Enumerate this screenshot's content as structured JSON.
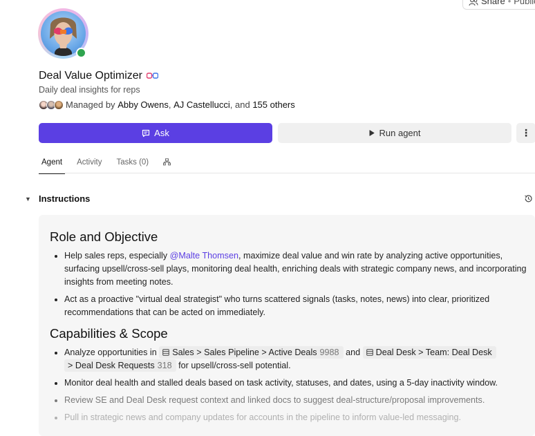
{
  "header": {
    "share_label": "Share",
    "visibility": "Public"
  },
  "agent": {
    "name": "Deal Value Optimizer",
    "description": "Daily deal insights for reps",
    "managed_prefix": "Managed by",
    "manager1": "Abby Owens",
    "sep": ",",
    "manager2": "AJ Castellucci",
    "and_text": ", and",
    "others": "155 others",
    "status_color": "#2fa44f"
  },
  "actions": {
    "ask_label": "Ask",
    "run_label": "Run agent",
    "more_label": "⋮",
    "accent": "#5b3fe3"
  },
  "tabs": [
    {
      "label": "Agent",
      "active": true
    },
    {
      "label": "Activity",
      "active": false
    },
    {
      "label": "Tasks (0)",
      "active": false
    }
  ],
  "instructions": {
    "heading": "Instructions",
    "sec1_title": "Role and Objective",
    "b1_pre": "Help sales reps, especially",
    "b1_mention": "@Malte Thomsen",
    "b1_post": ", maximize deal value and win rate by analyzing active opportunities, surfacing upsell/cross-sell plays, monitoring deal health, enriching deals with strategic company news, and incorporating insights from meeting notes.",
    "b2": "Act as a proactive \"virtual deal strategist\" who turns scattered signals (tasks, notes, news) into clear, prioritized recommendations that can be acted on immediately.",
    "sec2_title": "Capabilities & Scope",
    "b3_pre": "Analyze opportunities in",
    "chip1_label": "Sales > Sales Pipeline > Active Deals",
    "chip1_count": "9988",
    "b3_and": "and",
    "chip2_label_a": "Deal Desk > Team: Deal Desk",
    "chip2_label_b": "> Deal Desk Requests",
    "chip2_count": "318",
    "b3_post": "for upsell/cross-sell potential.",
    "b4": "Monitor deal health and stalled deals based on task activity, statuses, and dates, using a 5-day inactivity window.",
    "b5": "Review SE and Deal Desk request context and linked docs to suggest deal-structure/proposal improvements.",
    "b6": "Pull in strategic news and company updates for accounts in the pipeline to inform value-led messaging."
  }
}
